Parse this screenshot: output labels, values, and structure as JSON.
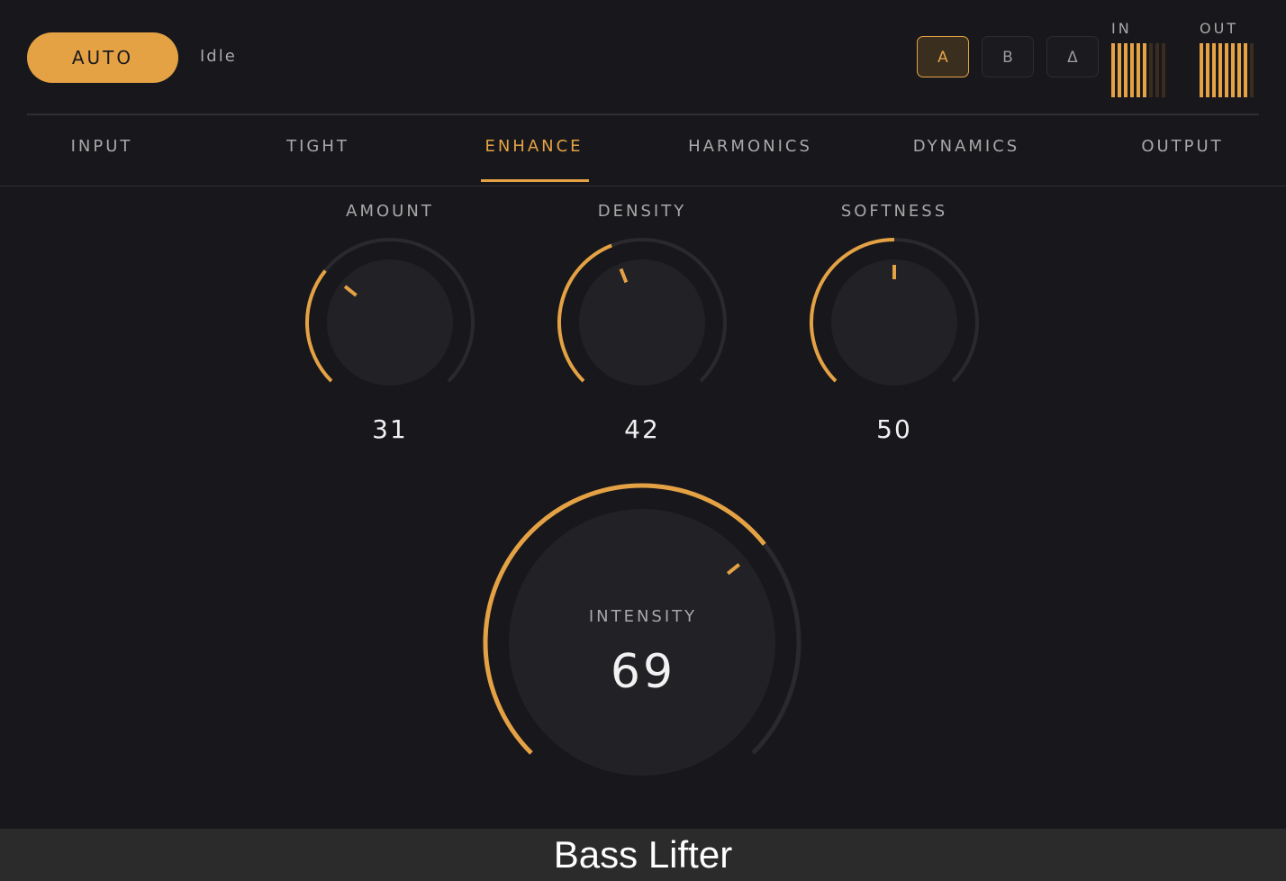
{
  "header": {
    "auto_label": "AUTO",
    "status_text": "Idle",
    "compare": {
      "a_label": "A",
      "b_label": "B",
      "delta_label": "Δ",
      "active": "A"
    },
    "meters": {
      "in_label": "IN",
      "out_label": "OUT"
    }
  },
  "tabs": [
    {
      "label": "INPUT"
    },
    {
      "label": "TIGHT"
    },
    {
      "label": "ENHANCE",
      "active": true
    },
    {
      "label": "HARMONICS"
    },
    {
      "label": "DYNAMICS"
    },
    {
      "label": "OUTPUT"
    }
  ],
  "knobs": [
    {
      "label": "AMOUNT",
      "value": "31",
      "level": 0.31
    },
    {
      "label": "DENSITY",
      "value": "42",
      "level": 0.42
    },
    {
      "label": "SOFTNESS",
      "value": "50",
      "level": 0.5
    }
  ],
  "intensity": {
    "label": "INTENSITY",
    "value": "69",
    "level": 0.69
  },
  "footer": {
    "title": "Bass Lifter"
  },
  "colors": {
    "accent": "#e5a244",
    "background": "#18181c",
    "track": "#2a2a2e",
    "knob_face": "#222226"
  }
}
